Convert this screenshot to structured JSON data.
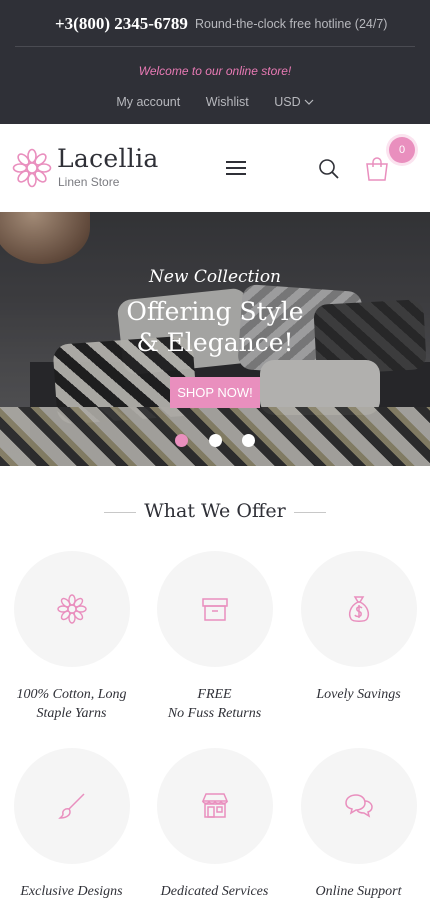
{
  "topbar": {
    "phone": "+3(800) 2345-6789",
    "hotline": "Round-the-clock free hotline (24/7)",
    "welcome": "Welcome to our online store!",
    "links": {
      "account": "My account",
      "wishlist": "Wishlist",
      "currency": "USD"
    }
  },
  "header": {
    "logo_name": "Lacellia",
    "logo_sub": "Linen Store",
    "cart_count": "0"
  },
  "hero": {
    "tag": "New Collection",
    "title_line1": "Offering Style",
    "title_line2": "& Elegance!",
    "button": "SHOP NOW!"
  },
  "offer": {
    "title": "What We Offer",
    "features": [
      {
        "line1": "100% Cotton, Long",
        "line2": "Staple Yarns",
        "icon": "flower-icon"
      },
      {
        "line1": "FREE",
        "line2": "No Fuss Returns",
        "icon": "box-icon"
      },
      {
        "line1": "Lovely Savings",
        "line2": "",
        "icon": "money-bag-icon"
      },
      {
        "line1": "Exclusive Designs",
        "line2": "",
        "icon": "brush-icon"
      },
      {
        "line1": "Dedicated Services",
        "line2": "",
        "icon": "store-icon"
      },
      {
        "line1": "Online Support",
        "line2": "",
        "icon": "chat-bubbles-icon"
      }
    ]
  },
  "colors": {
    "accent": "#e98fbe",
    "dark": "#2f3037",
    "circle_bg": "#f5f5f5"
  }
}
